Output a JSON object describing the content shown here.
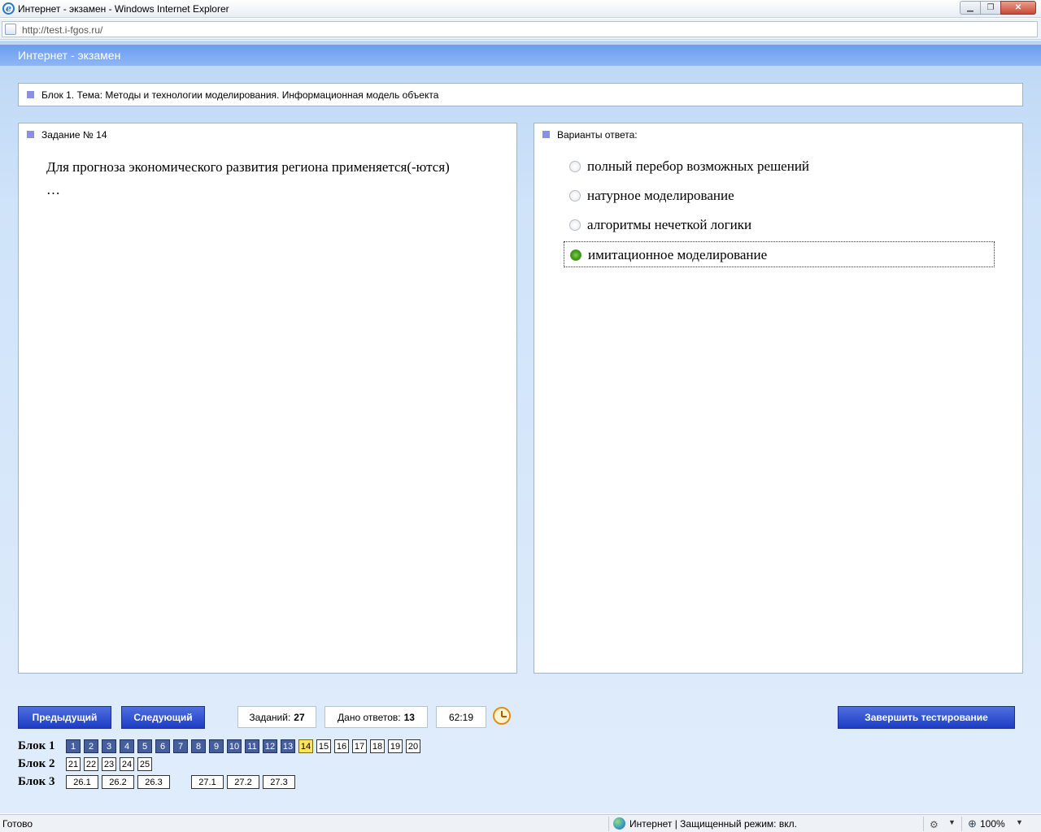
{
  "window": {
    "title": "Интернет - экзамен - Windows Internet Explorer",
    "url": "http://test.i-fgos.ru/"
  },
  "page": {
    "header": "Интернет - экзамен",
    "block_title": "Блок 1. Тема: Методы и технологии моделирования. Информационная модель объекта",
    "question_title": "Задание № 14",
    "question_text": "Для прогноза экономического развития региона применяется(-ются) …",
    "answers_title": "Варианты ответа:",
    "options": [
      {
        "text": "полный перебор возможных решений",
        "selected": false
      },
      {
        "text": "натурное моделирование",
        "selected": false
      },
      {
        "text": "алгоритмы нечеткой логики",
        "selected": false
      },
      {
        "text": "имитационное моделирование",
        "selected": true
      }
    ]
  },
  "controls": {
    "prev_label": "Предыдущий",
    "next_label": "Следующий",
    "tasks_label": "Заданий:",
    "tasks_count": "27",
    "answers_label": "Дано ответов:",
    "answers_count": "13",
    "timer": "62:19",
    "finish_label": "Завершить тестирование"
  },
  "navigation": {
    "block1": {
      "label": "Блок 1",
      "items": [
        {
          "n": "1",
          "state": "answered"
        },
        {
          "n": "2",
          "state": "answered"
        },
        {
          "n": "3",
          "state": "answered"
        },
        {
          "n": "4",
          "state": "answered"
        },
        {
          "n": "5",
          "state": "answered"
        },
        {
          "n": "6",
          "state": "answered"
        },
        {
          "n": "7",
          "state": "answered"
        },
        {
          "n": "8",
          "state": "answered"
        },
        {
          "n": "9",
          "state": "answered"
        },
        {
          "n": "10",
          "state": "answered"
        },
        {
          "n": "11",
          "state": "answered"
        },
        {
          "n": "12",
          "state": "answered"
        },
        {
          "n": "13",
          "state": "answered"
        },
        {
          "n": "14",
          "state": "current"
        },
        {
          "n": "15",
          "state": "open"
        },
        {
          "n": "16",
          "state": "open"
        },
        {
          "n": "17",
          "state": "open"
        },
        {
          "n": "18",
          "state": "open"
        },
        {
          "n": "19",
          "state": "open"
        },
        {
          "n": "20",
          "state": "open"
        }
      ]
    },
    "block2": {
      "label": "Блок 2",
      "items": [
        {
          "n": "21",
          "state": "open"
        },
        {
          "n": "22",
          "state": "open"
        },
        {
          "n": "23",
          "state": "open"
        },
        {
          "n": "24",
          "state": "open"
        },
        {
          "n": "25",
          "state": "open"
        }
      ]
    },
    "block3": {
      "label": "Блок 3",
      "items": [
        {
          "n": "26.1",
          "state": "open"
        },
        {
          "n": "26.2",
          "state": "open"
        },
        {
          "n": "26.3",
          "state": "open"
        },
        {
          "n": "27.1",
          "state": "open"
        },
        {
          "n": "27.2",
          "state": "open"
        },
        {
          "n": "27.3",
          "state": "open"
        }
      ]
    }
  },
  "statusbar": {
    "left": "Готово",
    "zone": "Интернет | Защищенный режим: вкл.",
    "zoom": "100%"
  }
}
